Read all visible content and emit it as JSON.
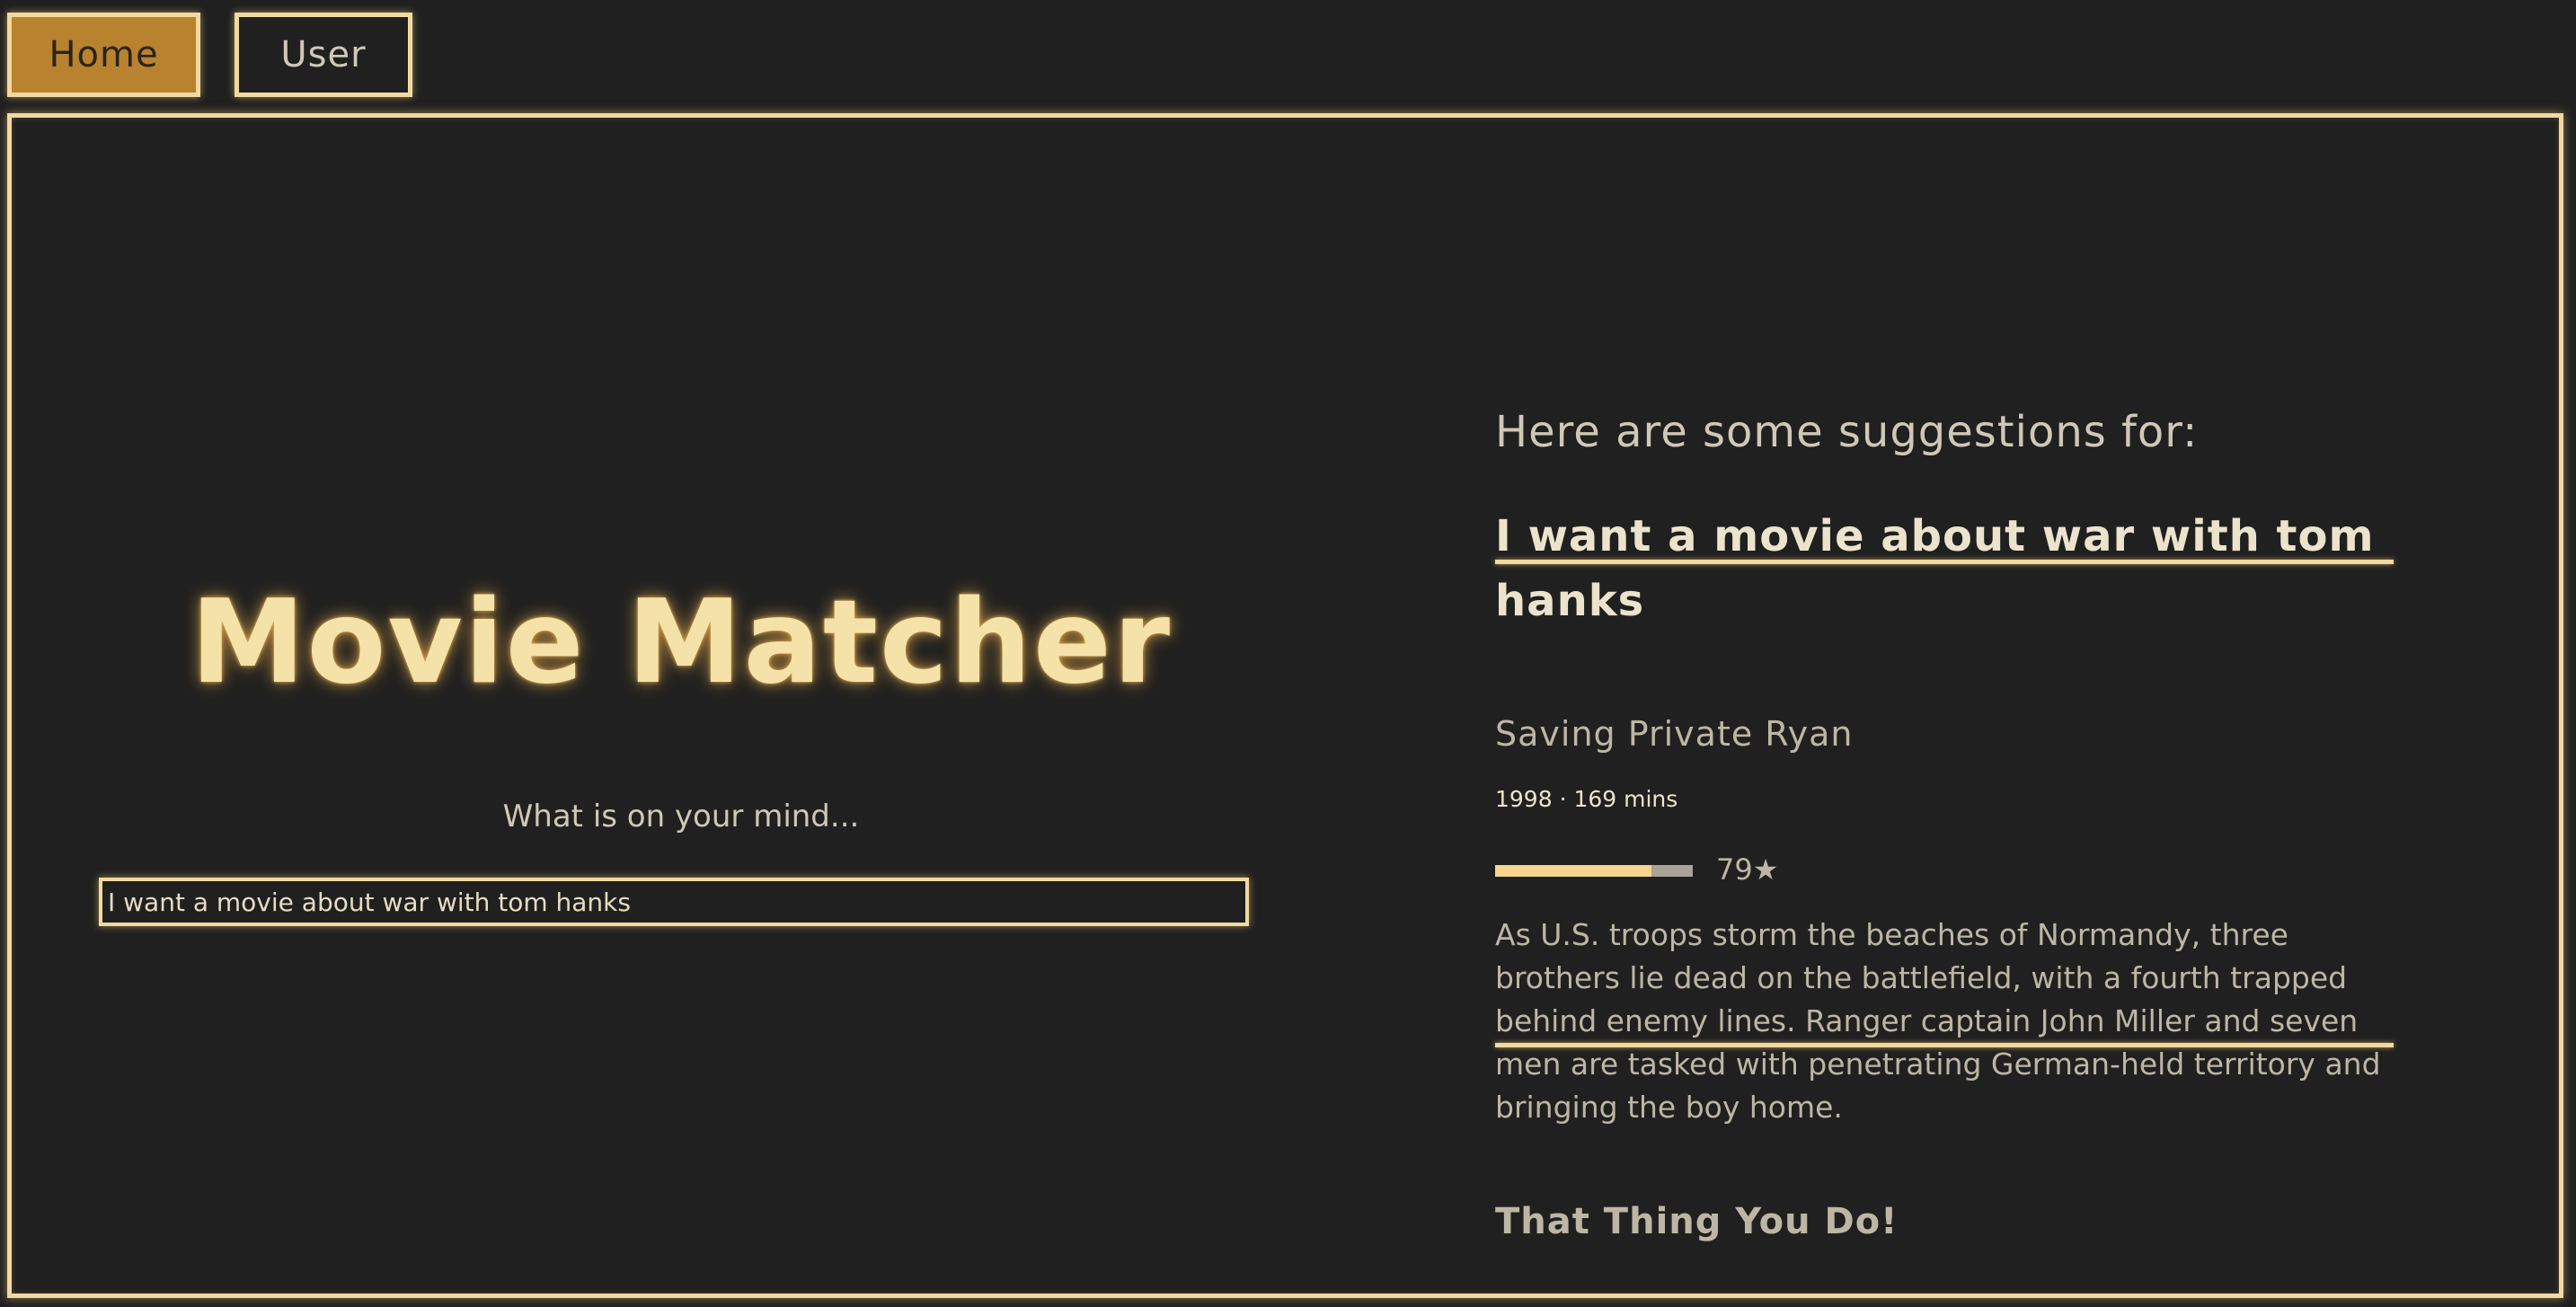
{
  "nav": {
    "home_label": "Home",
    "user_label": "User"
  },
  "main": {
    "app_title": "Movie Matcher",
    "prompt_label": "What is on your mind...",
    "search_value": "I want a movie about war with tom hanks"
  },
  "results": {
    "heading": "Here are some suggestions for:",
    "query": "I want a movie about war with tom hanks",
    "movies": [
      {
        "title": "Saving Private Ryan",
        "meta": "1998 · 169 mins",
        "rating": 79,
        "rating_label": "79★",
        "overview": "As U.S. troops storm the beaches of Normandy, three brothers lie dead on the battlefield, with a fourth trapped behind enemy lines. Ranger captain John Miller and seven men are tasked with penetrating German-held territory and bringing the boy home."
      },
      {
        "title": "That Thing You Do!"
      }
    ]
  },
  "colors": {
    "accent": "#f2d9a0",
    "home_active_bg": "#b9822f",
    "background": "#202020"
  }
}
